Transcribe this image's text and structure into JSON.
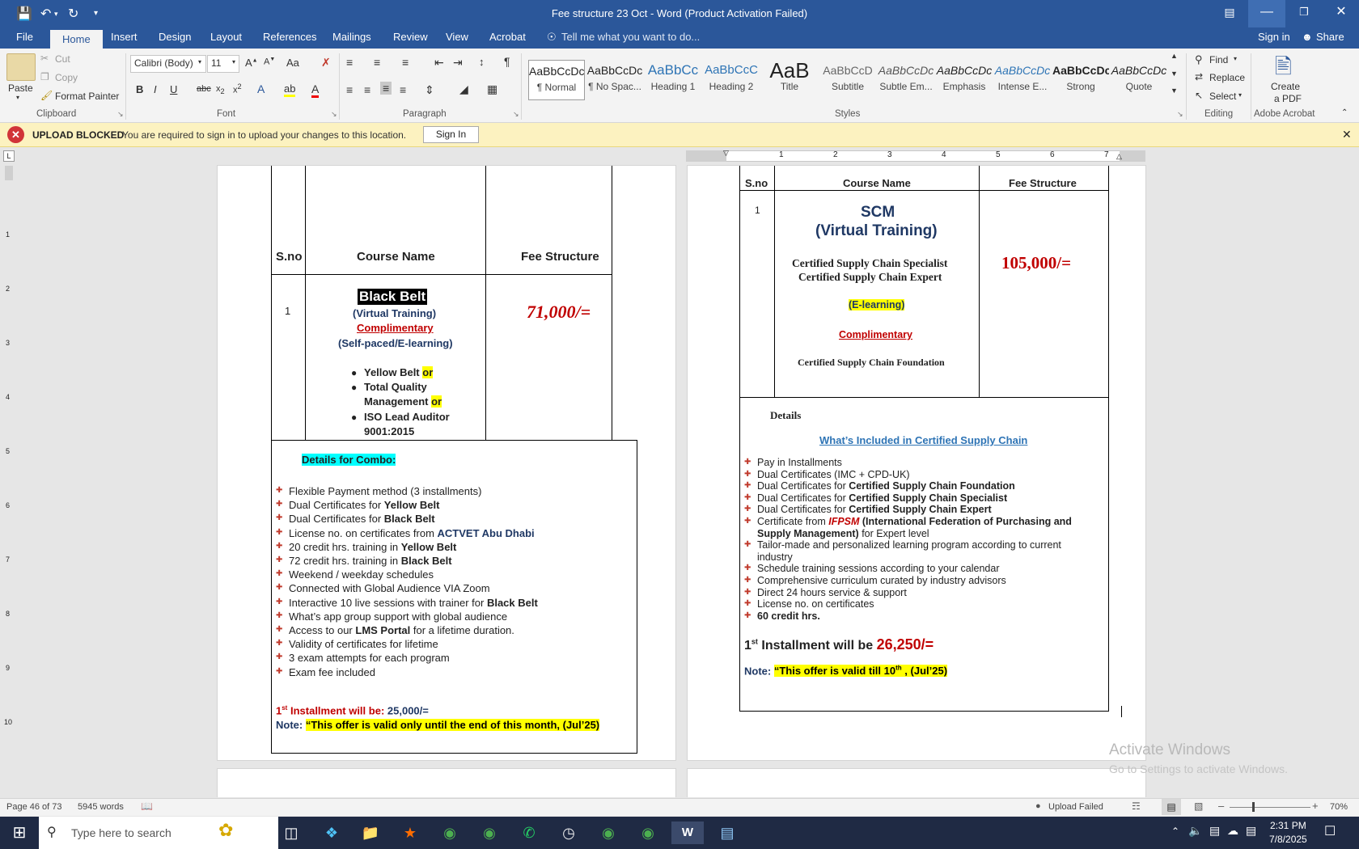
{
  "window": {
    "title": "Fee structure 23 Oct - Word (Product Activation Failed)"
  },
  "qat": {
    "save": "save-icon",
    "undo": "undo-icon",
    "redo": "redo-icon"
  },
  "tabs": [
    "File",
    "Home",
    "Insert",
    "Design",
    "Layout",
    "References",
    "Mailings",
    "Review",
    "View",
    "Acrobat"
  ],
  "tellme": "Tell me what you want to do...",
  "account": {
    "signin": "Sign in",
    "share": "Share"
  },
  "clipboard": {
    "paste": "Paste",
    "cut": "Cut",
    "copy": "Copy",
    "format_painter": "Format Painter",
    "label": "Clipboard"
  },
  "font": {
    "name": "Calibri (Body)",
    "size": "11",
    "label": "Font"
  },
  "paragraph": {
    "label": "Paragraph"
  },
  "styles": {
    "label": "Styles",
    "items": [
      {
        "preview": "AaBbCcDc",
        "name": "¶ Normal"
      },
      {
        "preview": "AaBbCcDc",
        "name": "¶ No Spac..."
      },
      {
        "preview": "AaBbCc",
        "name": "Heading 1"
      },
      {
        "preview": "AaBbCcC",
        "name": "Heading 2"
      },
      {
        "preview": "AaB",
        "name": "Title"
      },
      {
        "preview": "AaBbCcD",
        "name": "Subtitle"
      },
      {
        "preview": "AaBbCcDc",
        "name": "Subtle Em..."
      },
      {
        "preview": "AaBbCcDc",
        "name": "Emphasis"
      },
      {
        "preview": "AaBbCcDc",
        "name": "Intense E..."
      },
      {
        "preview": "AaBbCcDc",
        "name": "Strong"
      },
      {
        "preview": "AaBbCcDc",
        "name": "Quote"
      }
    ]
  },
  "editing": {
    "find": "Find",
    "replace": "Replace",
    "select": "Select",
    "label": "Editing"
  },
  "acrobat": {
    "create": "Create",
    "pdf": "a PDF",
    "label": "Adobe Acrobat"
  },
  "notification": {
    "title": "UPLOAD BLOCKED",
    "message": "You are required to sign in to upload your changes to this location.",
    "button": "Sign In"
  },
  "ruler_numbers": [
    "1",
    "2",
    "3",
    "4",
    "5",
    "6",
    "7"
  ],
  "vruler_numbers": [
    "1",
    "2",
    "3",
    "4",
    "5",
    "6",
    "7",
    "8",
    "9",
    "10"
  ],
  "left_page": {
    "headers": {
      "sno": "S.no",
      "course": "Course Name",
      "fee": "Fee Structure"
    },
    "row_no": "1",
    "course_title": "Black Belt",
    "mode": "(Virtual Training)",
    "complimentary": "Complimentary",
    "self_paced": "(Self-paced/E-learning)",
    "options": [
      {
        "text": "Yellow Belt ",
        "or": "or"
      },
      {
        "text": "Total Quality",
        "or": ""
      },
      {
        "text": "Management ",
        "or": "or"
      },
      {
        "text": "ISO Lead Auditor",
        "or": ""
      },
      {
        "text": "9001:2015",
        "or": ""
      }
    ],
    "fee": "71,000/=",
    "details_title": "Details for Combo:",
    "details": [
      [
        "Flexible Payment method (3 installments)",
        ""
      ],
      [
        " Dual Certificates for ",
        "Yellow Belt"
      ],
      [
        "Dual Certificates for ",
        "Black Belt"
      ],
      [
        "License no. on certificates from ",
        "ACTVET Abu Dhabi"
      ],
      [
        "20 credit hrs. training in ",
        "Yellow Belt"
      ],
      [
        "72 credit hrs. training in ",
        "Black Belt"
      ],
      [
        "Weekend / weekday schedules",
        ""
      ],
      [
        "Connected with Global Audience VIA Zoom",
        ""
      ],
      [
        "Interactive 10 live sessions with trainer for ",
        "Black Belt"
      ],
      [
        "What’s app group support with global audience",
        ""
      ],
      [
        "Access to our ",
        "LMS Portal",
        " for a lifetime duration."
      ],
      [
        "Validity of certificates for lifetime",
        ""
      ],
      [
        "3 exam attempts for each program",
        ""
      ],
      [
        "Exam fee included",
        ""
      ]
    ],
    "installment_a": "1",
    "installment_sup": "st",
    "installment_b": " Installment will be: ",
    "installment_amount": "25,000/=",
    "note_label": "Note: ",
    "note_text": "“This offer is valid only until the end of this month, (Jul’25)"
  },
  "right_page": {
    "headers": {
      "sno": "S.no",
      "course": "Course Name",
      "fee": "Fee Structure"
    },
    "row_no": "1",
    "course_title": "SCM",
    "mode": "(Virtual Training)",
    "cert1": "Certified Supply Chain Specialist",
    "cert2": "Certified Supply Chain Expert",
    "elearning": "(E-learning)",
    "complimentary": "Complimentary",
    "foundation": "Certified Supply Chain Foundation",
    "fee": "105,000/=",
    "details_title": "Details",
    "included": "What’s Included in Certified Supply Chain",
    "details": [
      [
        "Pay in Installments",
        ""
      ],
      [
        "Dual Certificates (IMC + CPD-UK)",
        ""
      ],
      [
        "Dual Certificates for ",
        "Certified Supply Chain Foundation"
      ],
      [
        "Dual Certificates for ",
        "Certified Supply Chain Specialist"
      ],
      [
        "Dual Certificates for ",
        "Certified Supply Chain Expert"
      ],
      [
        "Certificate from ",
        "IFPSM",
        "(International Federation of Purchasing and"
      ],
      [
        "",
        "Supply Management)",
        " for Expert level"
      ],
      [
        "Tailor-made and personalized learning program according to current",
        ""
      ],
      [
        "industry",
        ""
      ],
      [
        "Schedule training sessions according to your calendar",
        ""
      ],
      [
        "Comprehensive curriculum curated by industry advisors",
        ""
      ],
      [
        "Direct 24 hours service & support",
        ""
      ],
      [
        "License no. on certificates",
        ""
      ],
      [
        "",
        "60 credit hrs."
      ]
    ],
    "installment_a": "1",
    "installment_sup": "st",
    "installment_b": " Installment will be ",
    "installment_amount": "26,250/=",
    "note_label": "Note: ",
    "note_text_a": "“This offer is valid till 10",
    "note_sup": "th",
    "note_text_b": " , (Jul’25)"
  },
  "watermark": {
    "title": "Activate Windows",
    "sub": "Go to Settings to activate Windows."
  },
  "status": {
    "page": "Page 46 of 73",
    "words": "5945 words",
    "upload": "Upload Failed",
    "zoom": "70%"
  },
  "taskbar": {
    "search": "Type here to search",
    "time": "2:31 PM",
    "date": "7/8/2025"
  }
}
